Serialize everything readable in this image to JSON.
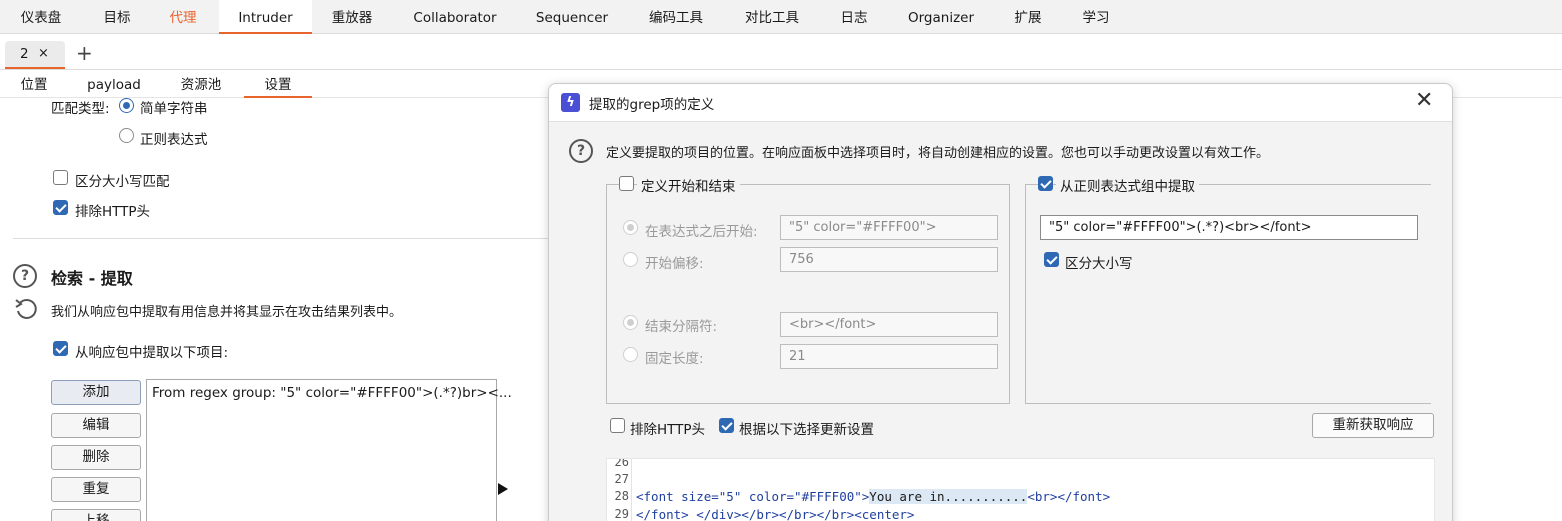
{
  "top_tabs": [
    "仪表盘",
    "目标",
    "代理",
    "Intruder",
    "重放器",
    "Collaborator",
    "Sequencer",
    "编码工具",
    "对比工具",
    "日志",
    "Organizer",
    "扩展",
    "学习"
  ],
  "instance": {
    "tab_label": "2",
    "close": "×",
    "add": "+"
  },
  "sub_tabs": [
    "位置",
    "payload",
    "资源池",
    "设置"
  ],
  "left": {
    "match_type_label": "匹配类型:",
    "simple_string": "简单字符串",
    "regex": "正则表达式",
    "case_sensitive": "区分大小写匹配",
    "exclude_http_headers": "排除HTTP头",
    "section_title": "检索 - 提取",
    "section_desc": "我们从响应包中提取有用信息并将其显示在攻击结果列表中。",
    "extract_checkbox": "从响应包中提取以下项目:",
    "buttons": [
      "添加",
      "编辑",
      "删除",
      "重复",
      "上移"
    ],
    "list_items": [
      "From regex group: \"5\" color=\"#FFFF00\">(.*?)br><..."
    ]
  },
  "dialog": {
    "title": "提取的grep项的定义",
    "close": "✕",
    "description": "定义要提取的项目的位置。在响应面板中选择项目时，将自动创建相应的设置。您也可以手动更改设置以有效工作。",
    "start_end": {
      "legend": "定义开始和结束",
      "start_after_label": "在表达式之后开始:",
      "start_after_value": "\"5\" color=\"#FFFF00\">",
      "start_offset_label": "开始偏移:",
      "start_offset_value": "756",
      "end_delim_label": "结束分隔符:",
      "end_delim_value": "<br></font>",
      "fixed_length_label": "固定长度:",
      "fixed_length_value": "21"
    },
    "regex_group": {
      "legend": "从正则表达式组中提取",
      "value": "\"5\" color=\"#FFFF00\">(.*?)<br></font>",
      "case_sensitive": "区分大小写"
    },
    "exclude_http_headers": "排除HTTP头",
    "update_by_selection": "根据以下选择更新设置",
    "refetch_button": "重新获取响应",
    "code": {
      "line_numbers": [
        "26",
        "27",
        "28",
        "29"
      ],
      "line28_a": "<font size=\"5\" color=\"#FFFF00\">",
      "line28_hl": "You are in...........",
      "line28_b": "<br></font>",
      "line29": "</font> </div></br></br></br><center>"
    }
  }
}
